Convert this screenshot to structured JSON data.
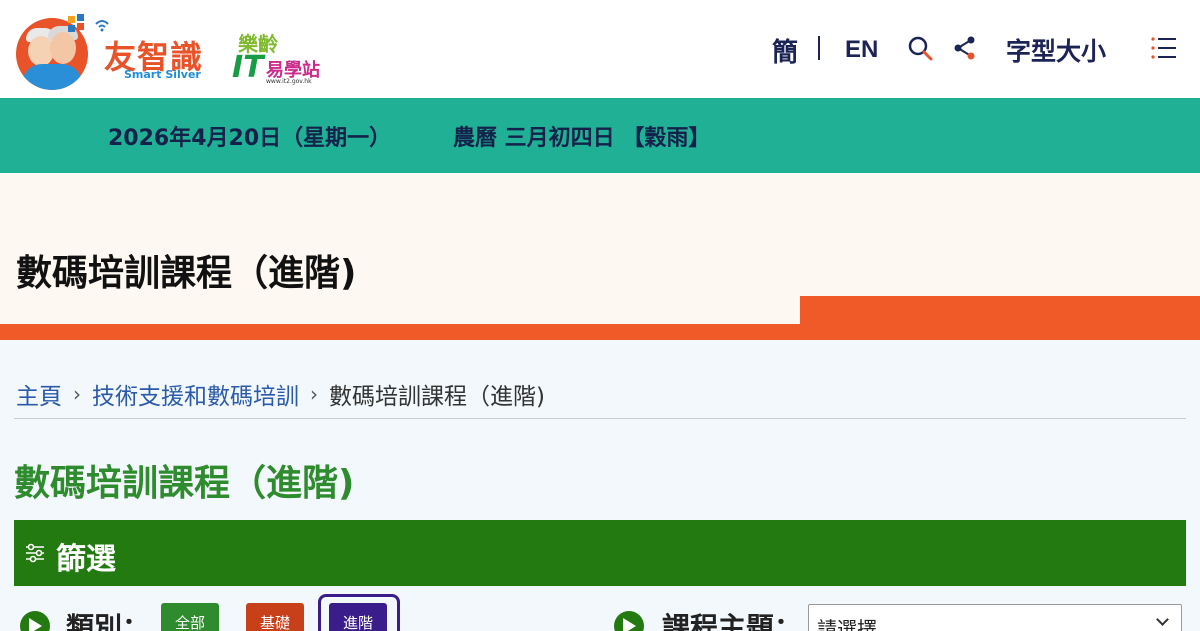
{
  "header": {
    "logo": {
      "title": "友智識",
      "subtitle": "Smart Silver",
      "partner_top": "樂齡",
      "partner_it": "IT",
      "partner_name": "易學站",
      "partner_url": "www.it2.gov.hk"
    },
    "lang_simplified": "簡",
    "lang_english": "EN",
    "search_icon": "search-icon",
    "share_icon": "share-icon",
    "font_size_label": "字型大小",
    "menu_icon": "menu-icon"
  },
  "datebar": {
    "date": "2026年4月20日（星期一）",
    "lunar": "農曆 三月初四日 【穀雨】"
  },
  "hero": {
    "title": "數碼培訓課程（進階)"
  },
  "breadcrumb": {
    "items": [
      "主頁",
      "技術支援和數碼培訓",
      "數碼培訓課程（進階)"
    ]
  },
  "page_title": "數碼培訓課程（進階)",
  "filter": {
    "heading": "篩選",
    "category_label": "類別：",
    "chips": [
      "全部",
      "基礎",
      "進階"
    ],
    "selected_chip": "進階",
    "topic_label": "課程主題：",
    "topic_value": "請選擇"
  },
  "colors": {
    "datebar": "#20b095",
    "accent_orange": "#f05a28",
    "filter_green": "#237a10",
    "title_green": "#2e8b2e",
    "selected_purple": "#3a1d8a"
  }
}
